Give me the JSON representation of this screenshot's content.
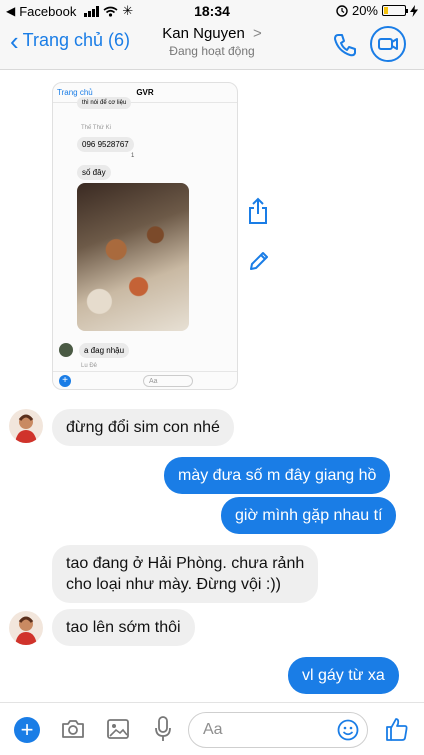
{
  "status_bar": {
    "back_app": "Facebook",
    "time": "18:34",
    "battery_percent": "20%",
    "battery_level": 0.2,
    "icons": [
      "back-arrow-icon",
      "signal-icon",
      "wifi-icon",
      "loading-icon",
      "alarm-icon",
      "battery-icon",
      "charging-icon"
    ]
  },
  "header": {
    "back_label": "Trang chủ (6)",
    "contact_name": "Kan Nguyen",
    "contact_chevron": ">",
    "contact_status": "Đang hoạt động",
    "icons": [
      "phone-icon",
      "video-call-icon"
    ]
  },
  "shared_screenshot": {
    "back_label": "Trang chủ",
    "title": "GVR",
    "top_message": "thì nói để cơ liệu",
    "sender_label": "Thế Thứ Ki",
    "phone_number": "096 9528767",
    "reaction_count": "1",
    "message_so_day": "số đây",
    "message_nhau": "a đag nhậu",
    "sender_label_2": "Lu Đê",
    "input_placeholder": "Aa"
  },
  "messages": [
    {
      "side": "in",
      "text": "đừng đổi sim con nhé"
    },
    {
      "side": "out",
      "text": "mày đưa số m đây giang hồ"
    },
    {
      "side": "out",
      "text": "giờ mình gặp nhau tí"
    },
    {
      "side": "in",
      "text": "tao đang ở Hải Phòng. chưa rảnh\ncho loại như mày. Đừng vội :))"
    },
    {
      "side": "in",
      "text": "tao lên sớm thôi"
    },
    {
      "side": "out",
      "text": "vl gáy từ xa"
    }
  ],
  "composer": {
    "placeholder": "Aa",
    "icons": [
      "plus-icon",
      "camera-icon",
      "gallery-icon",
      "microphone-icon",
      "emoji-icon",
      "thumbs-up-icon"
    ]
  },
  "colors": {
    "accent": "#1a7de6",
    "incoming_bubble": "#efefef",
    "outgoing_bubble": "#1a7de6",
    "battery_fill": "#f4c20d"
  }
}
